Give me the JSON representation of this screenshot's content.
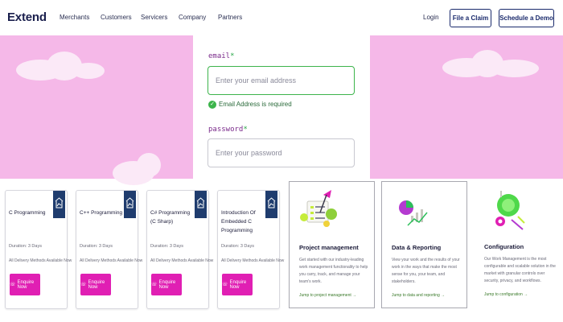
{
  "header": {
    "logo": "Extend",
    "nav": [
      "Merchants",
      "Customers",
      "Servicers",
      "Company",
      "Partners"
    ],
    "login": "Login",
    "file_claim": "File a Claim",
    "schedule_demo": "Schedule a Demo"
  },
  "form": {
    "email_label": "email",
    "email_required_mark": "*",
    "email_placeholder": "Enter your email address",
    "email_hint": "Email Address is required",
    "password_label": "password",
    "password_required_mark": "*",
    "password_placeholder": "Enter your password"
  },
  "courses": [
    {
      "title": "C Programming",
      "duration": "Duration: 3 Days",
      "methods": "All Delivery Methods Available Now",
      "cta": "Enquire Now"
    },
    {
      "title": "C++ Programming",
      "duration": "Duration: 3 Days",
      "methods": "All Delivery Methods Available Now",
      "cta": "Enquire Now"
    },
    {
      "title": "C# Programming (C Sharp)",
      "duration": "Duration: 3 Days",
      "methods": "All Delivery Methods Available Now",
      "cta": "Enquire Now"
    },
    {
      "title": "Introduction Of Embedded C Programming",
      "duration": "Duration: 3 Days",
      "methods": "All Delivery Methods Available Now",
      "cta": "Enquire Now"
    }
  ],
  "features": [
    {
      "title": "Project management",
      "desc": "Get started with our industry-leading work management functionality to help you carry, track, and manage your team's work.",
      "link": "Jump to project management →"
    },
    {
      "title": "Data & Reporting",
      "desc": "View your work and the results of your work in the ways that make the most sense for you, your team, and stakeholders.",
      "link": "Jump to data and reporting →"
    },
    {
      "title": "Configuration",
      "desc": "Our Work Management is the most configurable and scalable solution in the market with granular controls over security, privacy, and workflows.",
      "link": "Jump to configuration →"
    }
  ],
  "colors": {
    "pink_bg": "#f5b8e8",
    "accent_magenta": "#e01fb3",
    "navy": "#1a2a6c",
    "success_green": "#3cb44b"
  }
}
